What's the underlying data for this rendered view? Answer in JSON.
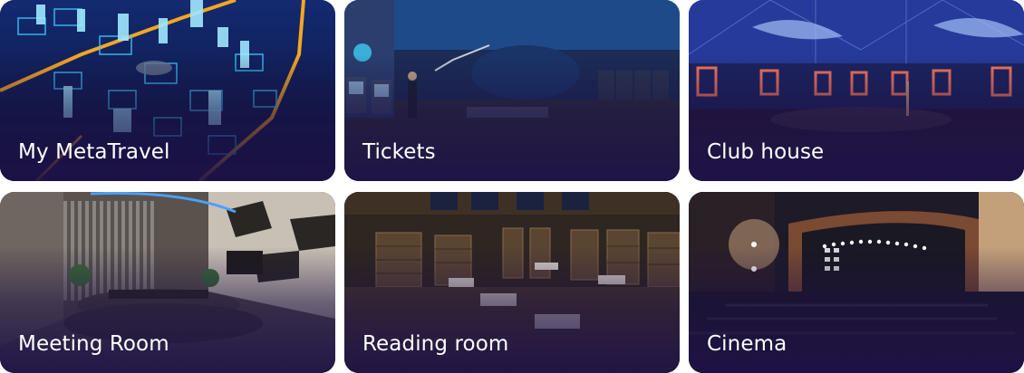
{
  "rooms": [
    {
      "label": "My MetaTravel",
      "icon": "city-map-scene"
    },
    {
      "label": "Tickets",
      "icon": "ticket-hall-scene"
    },
    {
      "label": "Club house",
      "icon": "club-house-scene"
    },
    {
      "label": "Meeting Room",
      "icon": "meeting-room-scene"
    },
    {
      "label": "Reading room",
      "icon": "library-scene"
    },
    {
      "label": "Cinema",
      "icon": "cinema-scene"
    }
  ]
}
